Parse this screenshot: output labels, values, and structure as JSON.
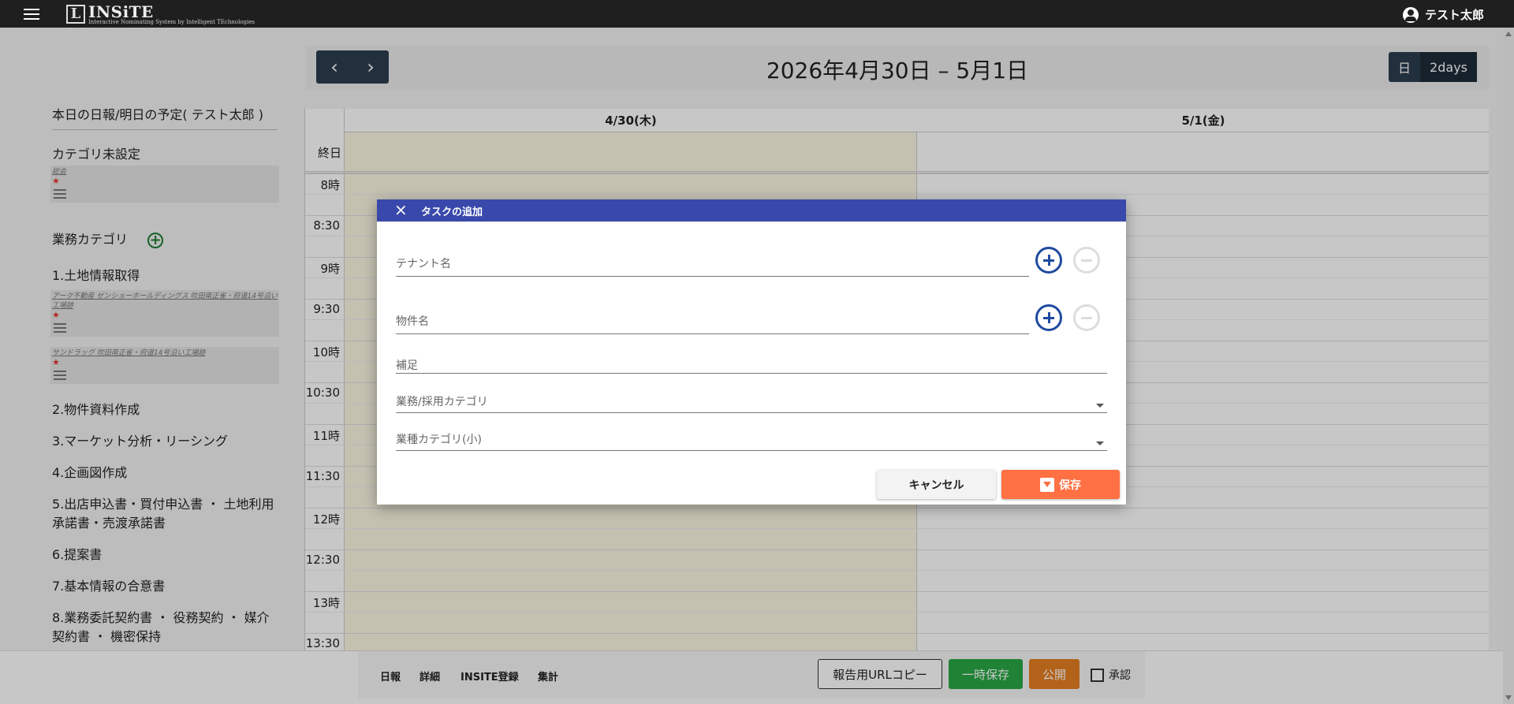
{
  "app": {
    "logo_letter": "L",
    "logo_word": "INSiTE",
    "logo_subtitle": "Interactive Nominating System by Intelligent TEchnologies",
    "user_name": "テスト太郎"
  },
  "calendar": {
    "prev": "‹",
    "next": "›",
    "title": "2026年4月30日 – 5月1日",
    "views": [
      "日",
      "2days"
    ],
    "columns": [
      "4/30(木)",
      "5/1(金)"
    ],
    "allday_label": "終日",
    "times": [
      "8時",
      "8:30",
      "9時",
      "9:30",
      "10時",
      "10:30",
      "11時",
      "11:30",
      "12時",
      "12:30",
      "13時",
      "13:30"
    ]
  },
  "sidebar": {
    "title": "本日の日報/明日の予定( テスト太郎 )",
    "uncategorized": {
      "heading": "カテゴリ未設定",
      "card_tags": "総会",
      "star": "★"
    },
    "business_heading": "業務カテゴリ",
    "add_icon": "+",
    "category1": "1.土地情報取得",
    "card1_tags": "アーク不動産 ゼンショーホールディングス 吹田南正雀・府道14号沿い工場跡",
    "card2_tags": "サンドラッグ 吹田南正雀・府道14号沿い工場跡",
    "star": "★",
    "items": [
      "2.物件資料作成",
      "3.マーケット分析・リーシング",
      "4.企画図作成",
      "5.出店申込書・買付申込書 ・ 土地利用承諾書・売渡承諾書",
      "6.提案書",
      "7.基本情報の合意書",
      "8.業務委託契約書 ・ 役務契約 ・ 媒介契約書 ・ 機密保持"
    ]
  },
  "footer": {
    "links": [
      "日報",
      "詳細",
      "INSITE登録",
      "集計"
    ],
    "url_copy": "報告用URLコピー",
    "temp_save": "一時保存",
    "publish": "公開",
    "approve": "承認"
  },
  "modal": {
    "close_icon": "×",
    "title": "タスクの追加",
    "tenant_placeholder": "テナント名",
    "property_placeholder": "物件名",
    "note_placeholder": "補足",
    "business_category_placeholder": "業務/採用カテゴリ",
    "industry_category_placeholder": "業種カテゴリ(小)",
    "cancel": "キャンセル",
    "save": "保存"
  },
  "colors": {
    "modal_header": "#3949ab",
    "save_button": "#ff7043",
    "temp_save_button": "#28a745",
    "publish_button": "#e67e22",
    "today_column": "#fcf8e3"
  }
}
